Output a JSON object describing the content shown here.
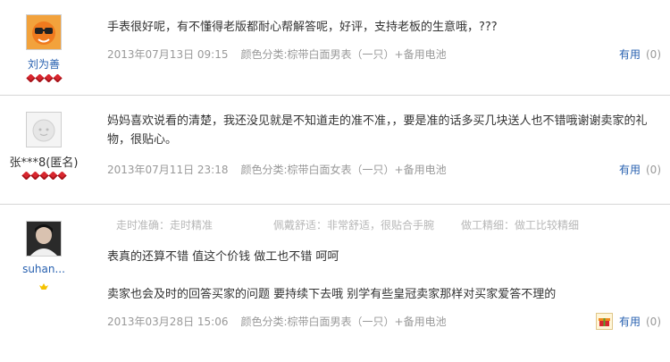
{
  "reviews": [
    {
      "user": "刘为善",
      "text": "手表很好呢，有不懂得老版都耐心帮解答呢，好评，支持老板的生意哦，???",
      "date": "2013年07月13日 09:15",
      "spec": "颜色分类:棕带白面男表（一只）+备用电池",
      "useful_label": "有用",
      "useful_count": "(0)"
    },
    {
      "user": "张***8(匿名)",
      "text": "妈妈喜欢说看的清楚，我还没见就是不知道走的准不准，，要是准的话多买几块送人也不错哦谢谢卖家的礼物，很贴心。",
      "date": "2013年07月11日 23:18",
      "spec": "颜色分类:棕带白面女表（一只）+备用电池",
      "useful_label": "有用",
      "useful_count": "(0)"
    },
    {
      "user": "suhan...",
      "ratings": [
        "走时准确：走时精准",
        "佩戴舒适：非常舒适，很贴合手腕",
        "做工精细：做工比较精细"
      ],
      "text_lines": [
        "表真的还算不错 值这个价钱 做工也不错 呵呵",
        "卖家也会及时的回答买家的问题 要持续下去哦 别学有些皇冠卖家那样对买家爱答不理的"
      ],
      "date": "2013年03月28日 15:06",
      "spec": "颜色分类:棕带白面男表（一只）+备用电池",
      "useful_label": "有用",
      "useful_count": "(0)"
    }
  ],
  "colors": {
    "link": "#2861b0",
    "meta": "#999999",
    "divider": "#d6d6d6",
    "gem": "#d8262e"
  }
}
